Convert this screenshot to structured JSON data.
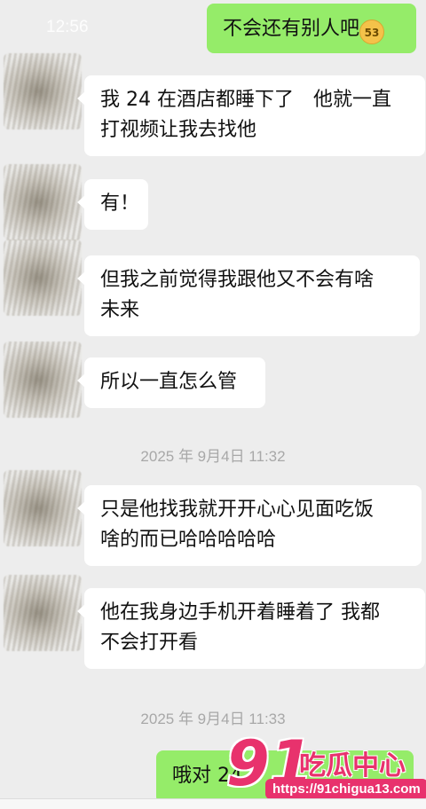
{
  "status_bar": {
    "time": "12:56"
  },
  "colors": {
    "background": "#ededed",
    "bubble_incoming": "#ffffff",
    "bubble_outgoing": "#95ec69",
    "watermark": "#e8326d"
  },
  "messages": [
    {
      "from": "me",
      "text": "不会还有别人吧"
    },
    {
      "from": "other",
      "lines": [
        "我 24 在酒店都睡下了　他就一直",
        "打视频让我去找他"
      ]
    },
    {
      "from": "other",
      "lines": [
        "有！"
      ]
    },
    {
      "from": "other",
      "lines": [
        "但我之前觉得我跟他又不会有啥",
        "未来"
      ]
    },
    {
      "from": "other",
      "lines": [
        "所以一直怎么管"
      ]
    },
    {
      "timestamp": "2025 年 9月4日 11:32"
    },
    {
      "from": "other",
      "lines": [
        "只是他找我就开开心心见面吃饭",
        "啥的而已哈哈哈哈哈"
      ]
    },
    {
      "from": "other",
      "lines": [
        "他在我身边手机开着睡着了 我都",
        "不会打开看"
      ]
    },
    {
      "timestamp": "2025 年 9月4日 11:33"
    },
    {
      "from": "me",
      "text": "哦对 24"
    }
  ],
  "emoji_badge": "53",
  "watermark": {
    "number": "91",
    "name": "吃瓜中心",
    "url": "https://91chigua13.com"
  }
}
